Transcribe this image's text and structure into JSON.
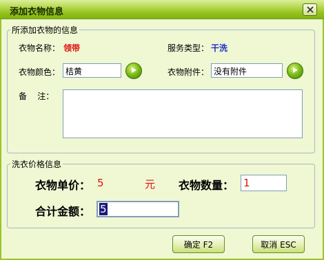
{
  "window": {
    "title": "添加衣物信息"
  },
  "info_group": {
    "legend": "所添加衣物的信息",
    "name_label": "衣物名称：",
    "name_value": "领带",
    "service_label": "服务类型：",
    "service_value": "干洗",
    "color_label": "衣物颜色：",
    "color_value": "桔黄",
    "accessory_label": "衣物附件：",
    "accessory_value": "没有附件",
    "remark_label": "备    注：",
    "remark_value": ""
  },
  "price_group": {
    "legend": "洗衣价格信息",
    "unit_price_label": "衣物单价：",
    "unit_price_value": "5",
    "unit_label": "元",
    "quantity_label": "衣物数量：",
    "quantity_value": "1",
    "total_label": "合计金额：",
    "total_value": "5"
  },
  "buttons": {
    "ok": "确定 F2",
    "cancel": "取消 ESC"
  },
  "colors": {
    "title_bar": "#94c21e",
    "client_bg": "#eff7d3",
    "red_value": "#e01010",
    "blue_value": "#1e2ec8"
  },
  "icons": {
    "close": "close-icon",
    "go": "arrow-right-icon"
  }
}
